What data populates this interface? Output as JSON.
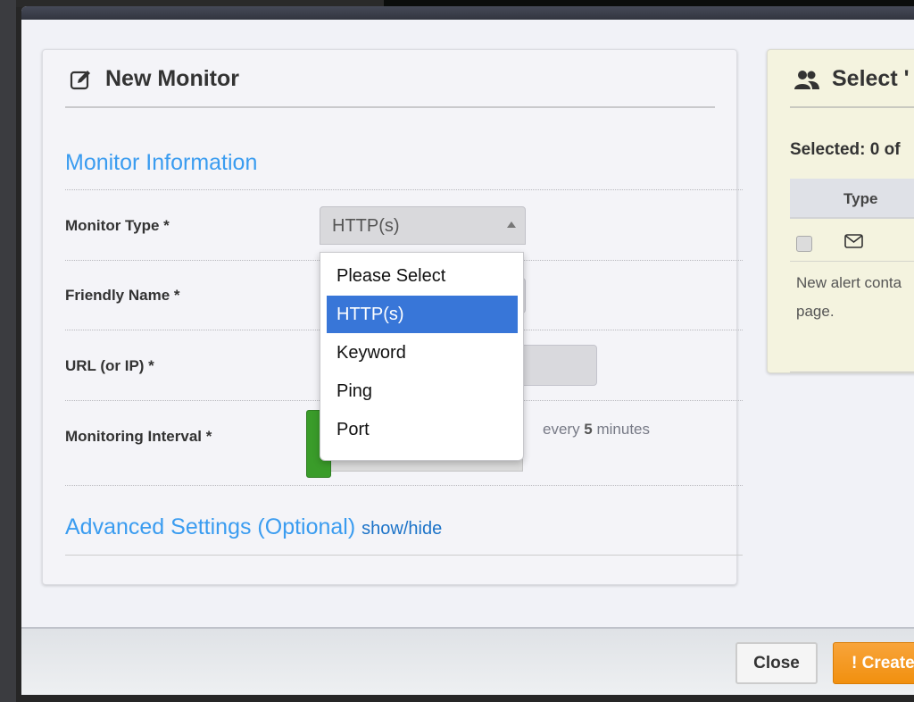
{
  "modal": {
    "main_panel": {
      "title": "New Monitor",
      "title_icon": "edit-icon",
      "section_info": "Monitor Information",
      "fields": [
        {
          "label": "Monitor Type *"
        },
        {
          "label": "Friendly Name *"
        },
        {
          "label": "URL (or IP) *"
        },
        {
          "label": "Monitoring Interval *"
        }
      ],
      "monitor_type": {
        "value": "HTTP(s)",
        "options": [
          "Please Select",
          "HTTP(s)",
          "Keyword",
          "Ping",
          "Port"
        ],
        "selected_index": 1
      },
      "interval": {
        "prefix": "every ",
        "value": "5",
        "suffix": " minutes"
      },
      "section_advanced": "Advanced Settings (Optional)",
      "show_hide": "show/hide"
    },
    "side_panel": {
      "title": "Select '",
      "title_icon": "users-icon",
      "selected_count": "Selected: 0 of",
      "table_header_type": "Type",
      "row_icon": "envelope-icon",
      "note_line1": "New alert conta",
      "note_line2": "page."
    },
    "footer": {
      "close_label": "Close",
      "create_label": "! Create"
    }
  }
}
